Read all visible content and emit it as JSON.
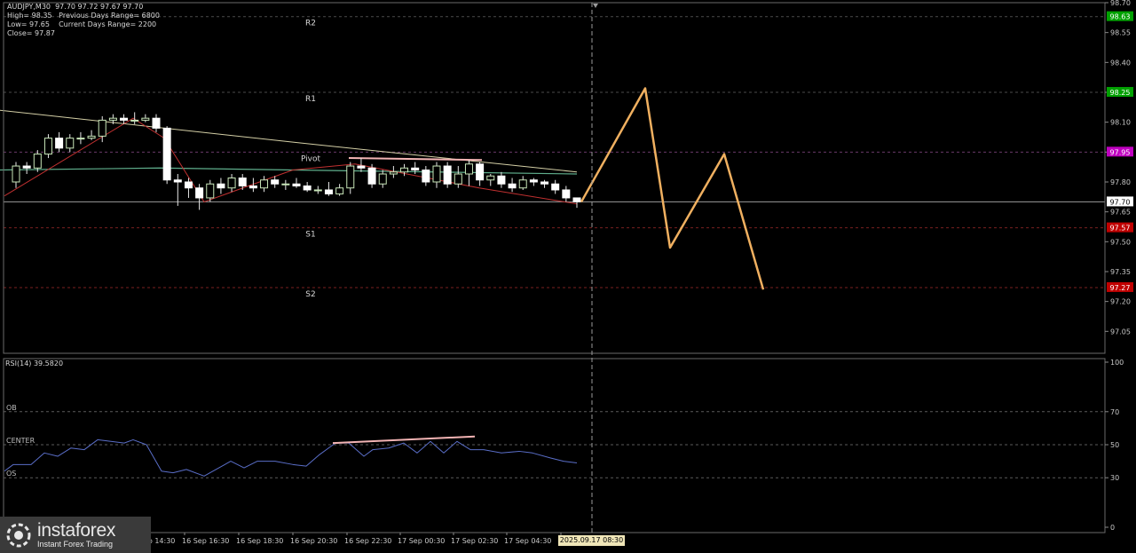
{
  "header": {
    "symbol_line": "AUDJPY,M30  97.70 97.72 97.67 97.70",
    "high_line": "High= 98.35   Previous Days Range= 6800",
    "low_line": "Low= 97.65    Current Days Range= 2200",
    "close_line": "Close= 97.87"
  },
  "levels": {
    "R2": 98.63,
    "R1": 98.25,
    "Pivot": 97.95,
    "S1": 97.57,
    "S2": 97.27,
    "labels": {
      "R2": "R2",
      "R1": "R1",
      "Pivot": "Pivot",
      "S1": "S1",
      "S2": "S2"
    },
    "tags": {
      "R2": "98.63",
      "R1": "98.25",
      "Pivot": "97.95",
      "S1": "97.57",
      "S2": "97.27"
    }
  },
  "current_price": 97.7,
  "current_price_label": "97.70",
  "colors": {
    "background": "#000000",
    "grid": "#3a3a3a",
    "bull": "#c8e6b8",
    "bear": "#ffffff",
    "projection": "#f0b060",
    "r2_tag": "#00a000",
    "r1_tag": "#00a000",
    "pivot_tag": "#c000c0",
    "s_tag": "#c00000",
    "rsi_line": "#5a6ec8",
    "divergence": "#f3b4b4",
    "ma_slow": "#d4cfa6",
    "ma_fast": "#5fae8c",
    "trend": "#c03030"
  },
  "chart_data": [
    {
      "type": "candlestick",
      "title": "AUDJPY,M30",
      "ylim": [
        96.94,
        98.7
      ],
      "y_ticks": [
        "98.70",
        "98.55",
        "98.40",
        "98.25",
        "98.10",
        "97.95",
        "97.80",
        "97.65",
        "97.50",
        "97.35",
        "97.20",
        "97.05"
      ],
      "x_ticks": [
        "16 Sep 14:30",
        "16 Sep 16:30",
        "16 Sep 18:30",
        "16 Sep 20:30",
        "16 Sep 22:30",
        "17 Sep 00:30",
        "17 Sep 02:30",
        "17 Sep 04:30",
        "17 Sep 06:30"
      ],
      "current_time_label": "2025.09.17 08:30",
      "candles": [
        [
          97.8,
          97.88,
          97.9,
          97.77
        ],
        [
          97.88,
          97.87,
          97.9,
          97.84
        ],
        [
          97.87,
          97.94,
          97.96,
          97.85
        ],
        [
          97.94,
          98.02,
          98.04,
          97.92
        ],
        [
          98.02,
          97.97,
          98.05,
          97.95
        ],
        [
          97.97,
          98.02,
          98.04,
          97.95
        ],
        [
          98.02,
          98.02,
          98.05,
          97.99
        ],
        [
          98.02,
          98.03,
          98.06,
          98.01
        ],
        [
          98.03,
          98.11,
          98.13,
          98.0
        ],
        [
          98.11,
          98.12,
          98.14,
          98.09
        ],
        [
          98.12,
          98.11,
          98.14,
          98.09
        ],
        [
          98.11,
          98.11,
          98.15,
          98.09
        ],
        [
          98.11,
          98.12,
          98.14,
          98.1
        ],
        [
          98.12,
          98.07,
          98.14,
          98.05
        ],
        [
          98.07,
          97.81,
          98.08,
          97.79
        ],
        [
          97.81,
          97.8,
          97.84,
          97.68
        ],
        [
          97.8,
          97.77,
          97.82,
          97.72
        ],
        [
          97.77,
          97.72,
          97.79,
          97.66
        ],
        [
          97.72,
          97.79,
          97.81,
          97.7
        ],
        [
          97.79,
          97.77,
          97.82,
          97.74
        ],
        [
          97.77,
          97.82,
          97.84,
          97.75
        ],
        [
          97.82,
          97.78,
          97.84,
          97.76
        ],
        [
          97.78,
          97.77,
          97.82,
          97.75
        ],
        [
          97.77,
          97.81,
          97.83,
          97.75
        ],
        [
          97.81,
          97.79,
          97.83,
          97.77
        ],
        [
          97.79,
          97.79,
          97.81,
          97.76
        ],
        [
          97.79,
          97.78,
          97.82,
          97.77
        ],
        [
          97.78,
          97.76,
          97.8,
          97.75
        ],
        [
          97.76,
          97.76,
          97.78,
          97.74
        ],
        [
          97.76,
          97.74,
          97.8,
          97.73
        ],
        [
          97.74,
          97.77,
          97.79,
          97.73
        ],
        [
          97.77,
          97.88,
          97.9,
          97.74
        ],
        [
          97.88,
          97.87,
          97.92,
          97.85
        ],
        [
          97.87,
          97.79,
          97.89,
          97.77
        ],
        [
          97.79,
          97.84,
          97.86,
          97.77
        ],
        [
          97.84,
          97.85,
          97.88,
          97.82
        ],
        [
          97.85,
          97.87,
          97.89,
          97.83
        ],
        [
          97.87,
          97.86,
          97.9,
          97.84
        ],
        [
          97.86,
          97.8,
          97.88,
          97.78
        ],
        [
          97.8,
          97.88,
          97.9,
          97.77
        ],
        [
          97.88,
          97.79,
          97.9,
          97.77
        ],
        [
          97.79,
          97.84,
          97.88,
          97.77
        ],
        [
          97.84,
          97.89,
          97.91,
          97.78
        ],
        [
          97.89,
          97.81,
          97.9,
          97.78
        ],
        [
          97.81,
          97.83,
          97.84,
          97.78
        ],
        [
          97.83,
          97.79,
          97.85,
          97.77
        ],
        [
          97.79,
          97.77,
          97.82,
          97.75
        ],
        [
          97.77,
          97.81,
          97.83,
          97.76
        ],
        [
          97.81,
          97.8,
          97.82,
          97.78
        ],
        [
          97.8,
          97.79,
          97.81,
          97.77
        ],
        [
          97.79,
          97.76,
          97.81,
          97.74
        ],
        [
          97.76,
          97.72,
          97.78,
          97.7
        ],
        [
          97.72,
          97.7,
          97.72,
          97.67
        ]
      ],
      "ma_slow": [
        [
          0,
          98.16
        ],
        [
          330,
          98.0
        ],
        [
          650,
          97.85
        ]
      ],
      "ma_fast": [
        [
          0,
          97.86
        ],
        [
          180,
          97.87
        ],
        [
          330,
          97.86
        ],
        [
          650,
          97.84
        ]
      ],
      "trend_line": [
        [
          5,
          97.73
        ],
        [
          150,
          98.12
        ],
        [
          185,
          98.02
        ],
        [
          230,
          97.7
        ],
        [
          330,
          97.86
        ],
        [
          400,
          97.89
        ],
        [
          540,
          97.77
        ],
        [
          650,
          97.69
        ]
      ],
      "divergence_segment": [
        [
          393,
          97.92
        ],
        [
          543,
          97.91
        ]
      ],
      "projection": [
        [
          655,
          97.7
        ],
        [
          727,
          98.27
        ],
        [
          755,
          97.47
        ],
        [
          816,
          97.94
        ],
        [
          860,
          97.26
        ]
      ]
    },
    {
      "type": "line",
      "title": "RSI(14) 39.5820",
      "ylim": [
        0,
        100
      ],
      "y_ticks": [
        "100",
        "70",
        "50",
        "30",
        "0"
      ],
      "levels": [
        {
          "name": "OB",
          "value": 70
        },
        {
          "name": "CENTER",
          "value": 50
        },
        {
          "name": "OS",
          "value": 30
        }
      ],
      "series": [
        {
          "name": "RSI(14)",
          "values": [
            [
              5,
              34
            ],
            [
              15,
              38
            ],
            [
              35,
              38
            ],
            [
              50,
              45
            ],
            [
              65,
              43
            ],
            [
              80,
              48
            ],
            [
              95,
              47
            ],
            [
              110,
              53
            ],
            [
              125,
              52
            ],
            [
              140,
              51
            ],
            [
              150,
              53
            ],
            [
              165,
              50
            ],
            [
              182,
              34
            ],
            [
              195,
              33
            ],
            [
              210,
              35
            ],
            [
              230,
              31
            ],
            [
              250,
              37
            ],
            [
              260,
              40
            ],
            [
              275,
              36
            ],
            [
              290,
              40
            ],
            [
              310,
              40
            ],
            [
              330,
              38
            ],
            [
              345,
              37
            ],
            [
              360,
              44
            ],
            [
              378,
              51
            ],
            [
              393,
              51
            ],
            [
              410,
              43
            ],
            [
              420,
              47
            ],
            [
              438,
              48
            ],
            [
              455,
              51
            ],
            [
              470,
              45
            ],
            [
              485,
              52
            ],
            [
              500,
              45
            ],
            [
              515,
              52
            ],
            [
              530,
              47
            ],
            [
              545,
              47
            ],
            [
              565,
              45
            ],
            [
              585,
              46
            ],
            [
              600,
              45
            ],
            [
              620,
              42
            ],
            [
              635,
              40
            ],
            [
              650,
              39
            ]
          ]
        }
      ],
      "divergence_segment": [
        [
          375,
          51
        ],
        [
          535,
          55
        ]
      ]
    }
  ],
  "logo": {
    "name": "instaforex",
    "tagline": "Instant Forex Trading"
  }
}
